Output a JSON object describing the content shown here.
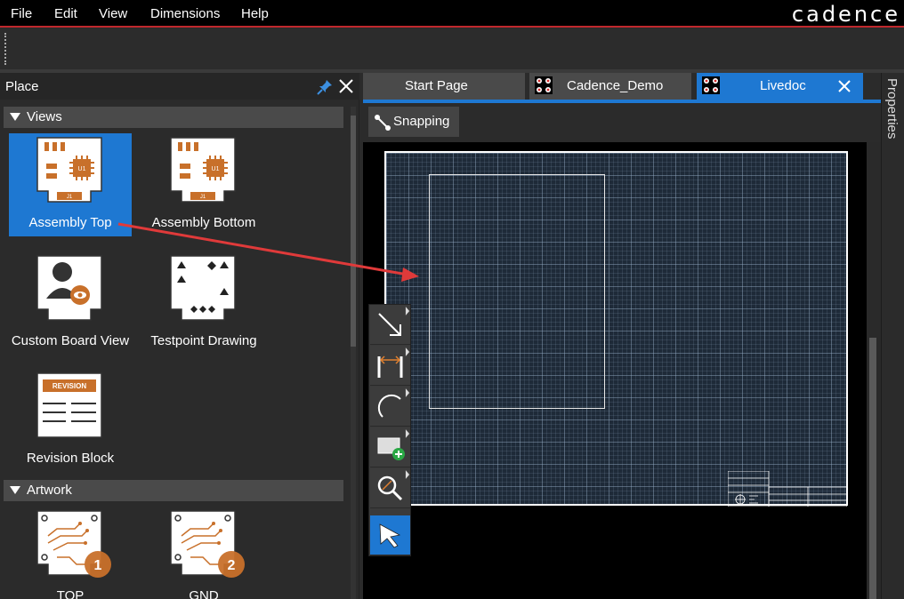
{
  "menubar": {
    "items": [
      "File",
      "Edit",
      "View",
      "Dimensions",
      "Help"
    ],
    "logo": "cadence"
  },
  "place_panel": {
    "title": "Place",
    "sections": [
      {
        "label": "Views"
      },
      {
        "label": "Artwork"
      }
    ],
    "views": [
      {
        "label": "Assembly Top",
        "selected": true
      },
      {
        "label": "Assembly Bottom",
        "selected": false
      },
      {
        "label": "Custom Board View",
        "selected": false
      },
      {
        "label": "Testpoint Drawing",
        "selected": false
      },
      {
        "label": "Revision Block",
        "selected": false,
        "thumb_text": "REVISION"
      }
    ],
    "artwork": [
      {
        "label": "TOP",
        "badge": "1"
      },
      {
        "label": "GND",
        "badge": "2"
      }
    ],
    "thumb_texts": {
      "u1": "U1",
      "j1": "J1"
    }
  },
  "tabs": [
    {
      "label": "Start Page",
      "active": false
    },
    {
      "label": "Cadence_Demo",
      "active": false
    },
    {
      "label": "Livedoc",
      "active": true
    }
  ],
  "doc_toolbar": {
    "snapping_label": "Snapping"
  },
  "properties": {
    "label": "Properties"
  },
  "tools": [
    {
      "name": "line-tool",
      "active": false
    },
    {
      "name": "dimension-tool",
      "active": false
    },
    {
      "name": "arc-tool",
      "active": false
    },
    {
      "name": "add-view-tool",
      "active": false
    },
    {
      "name": "zoom-tool",
      "active": false
    },
    {
      "name": "select-tool",
      "active": true
    }
  ],
  "colors": {
    "accent_blue": "#1e78d2",
    "brand_red": "#c0282d",
    "pcb_orange": "#c8702a",
    "annotation_red": "#e03a3a"
  }
}
